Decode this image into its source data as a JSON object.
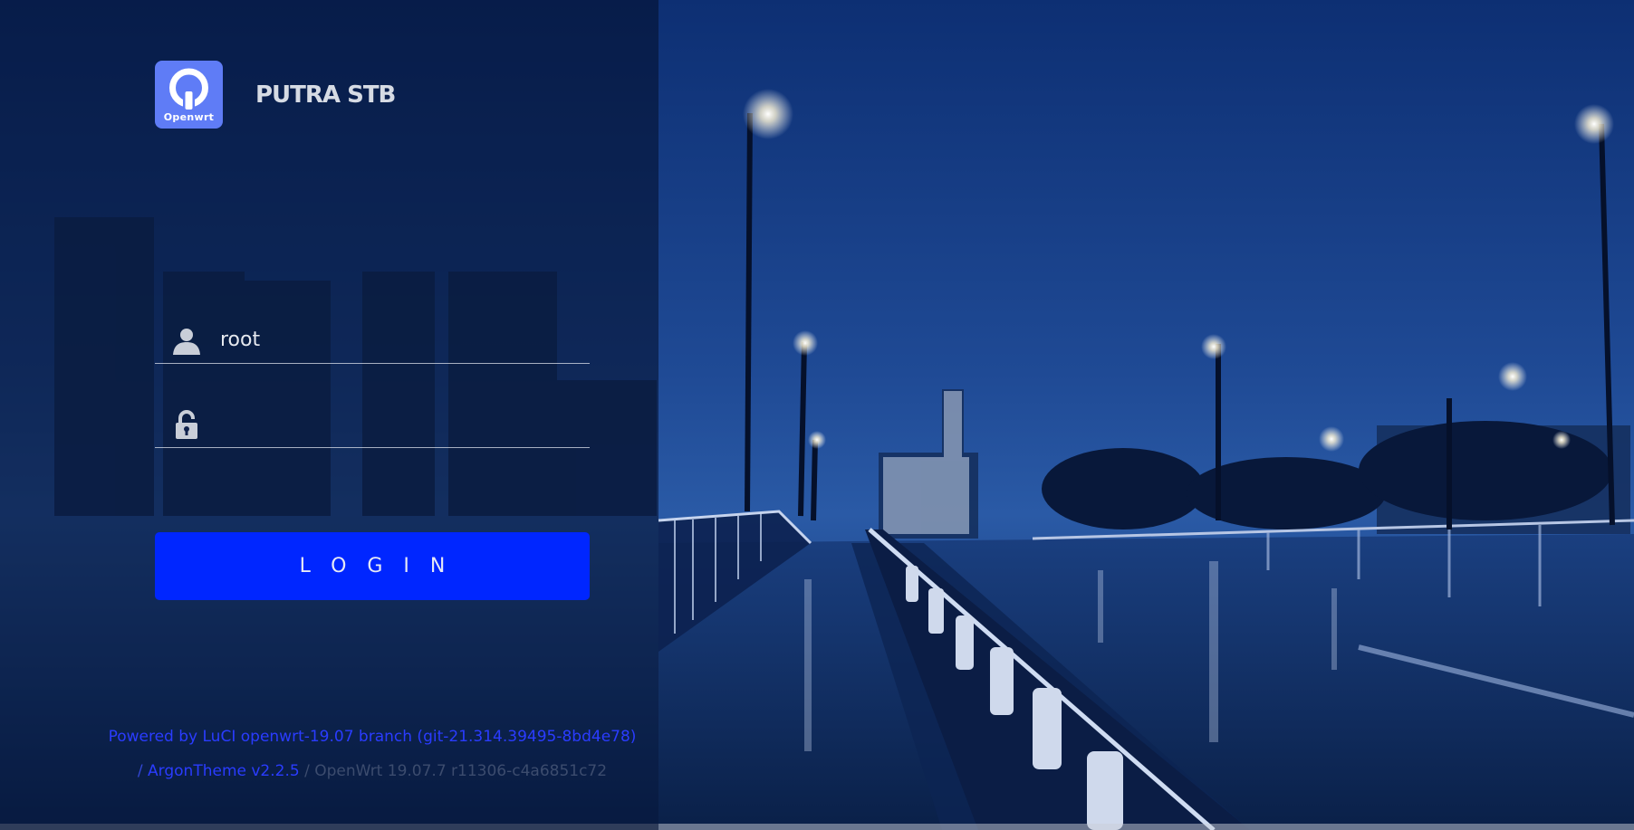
{
  "brand": {
    "logo_text": "Openwrt",
    "name": "PUTRA STB"
  },
  "login_form": {
    "username_value": "root",
    "password_value": "",
    "login_label": "LOGIN"
  },
  "footer": {
    "powered_by": "Powered by LuCI openwrt-19.07 branch (git-21.314.39495-8bd4e78)",
    "separator": "/",
    "theme_link": "ArgonTheme v2.2.5",
    "version_text": "/ OpenWrt 19.07.7 r11306-c4a6851c72"
  },
  "colors": {
    "accent": "#0026ff",
    "logo_bg": "#5f7cf6",
    "link": "#2a3cff"
  },
  "icons": {
    "user": "user-icon",
    "lock": "unlock-icon",
    "logo": "openwrt-logo-icon"
  }
}
